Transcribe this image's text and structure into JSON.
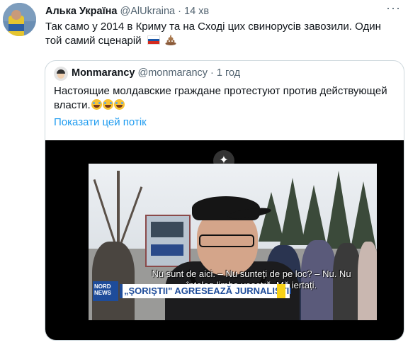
{
  "tweet": {
    "author_name": "Алька Україна",
    "author_handle": "@AlUkraina",
    "separator": "·",
    "time": "14 хв",
    "more_label": "···",
    "text": "Так само у 2014 в Криму та на Сході цих свинорусів завозили. Один той самий сценарій",
    "emojis": [
      "flag-russia-icon",
      "pile-of-poo-icon"
    ]
  },
  "quoted": {
    "author_name": "Monmarancy",
    "author_handle": "@monmarancy",
    "separator": "·",
    "time": "1 год",
    "text": "Настоящие молдавские граждане протестуют против действующей власти.",
    "emojis": [
      "laughing-tears-icon",
      "laughing-tears-icon",
      "laughing-tears-icon"
    ],
    "show_thread": "Показати цей потік"
  },
  "video": {
    "sparkle_label": "✦",
    "subtitle": "Nu sunt de aici. – Nu sunteți de pe loc? – Nu. Nu înțeleg limba voastră. Mă iertați.",
    "logo": "NORD NEWS",
    "headline": "„ŞORIŞTII\" AGRESEAZĂ JURNALIŞTII"
  },
  "colors": {
    "link": "#1d9bf0",
    "muted": "#536471",
    "border": "#cfd9de"
  }
}
